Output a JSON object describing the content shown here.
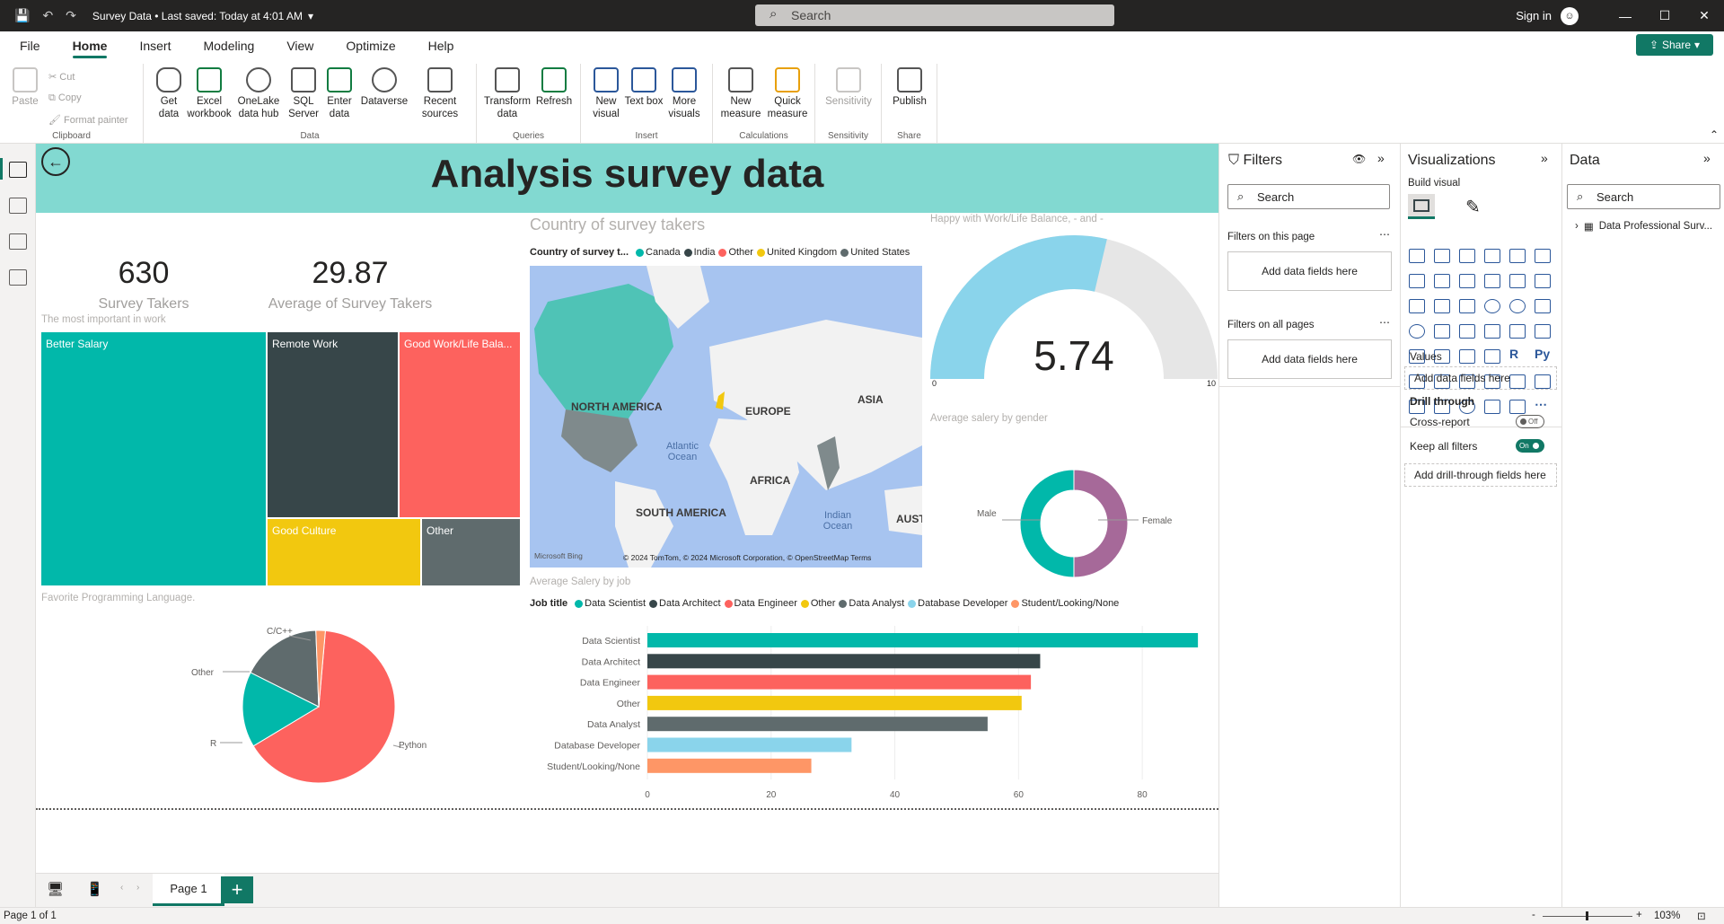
{
  "titlebar": {
    "doc_title": "Survey Data • Last saved: Today at 4:01 AM",
    "search_placeholder": "Search",
    "signin": "Sign in",
    "share": "Share"
  },
  "menu": [
    "File",
    "Home",
    "Insert",
    "Modeling",
    "View",
    "Optimize",
    "Help"
  ],
  "ribbon": {
    "clipboard": {
      "paste": "Paste",
      "cut": "Cut",
      "copy": "Copy",
      "format_painter": "Format painter",
      "label": "Clipboard"
    },
    "data": {
      "get_data": "Get data",
      "excel": "Excel workbook",
      "onelake": "OneLake data hub",
      "sql": "SQL Server",
      "enter": "Enter data",
      "dataverse": "Dataverse",
      "recent": "Recent sources",
      "label": "Data"
    },
    "queries": {
      "transform": "Transform data",
      "refresh": "Refresh",
      "label": "Queries"
    },
    "insert": {
      "new_visual": "New visual",
      "text_box": "Text box",
      "more_visuals": "More visuals",
      "label": "Insert"
    },
    "calculations": {
      "new_measure": "New measure",
      "quick_measure": "Quick measure",
      "label": "Calculations"
    },
    "sensitivity": {
      "sensitivity": "Sensitivity",
      "label": "Sensitivity"
    },
    "share": {
      "publish": "Publish",
      "label": "Share"
    }
  },
  "report": {
    "title": "Analysis survey data",
    "kpi1": {
      "value": "630",
      "label": "Survey Takers"
    },
    "kpi2": {
      "value": "29.87",
      "label": "Average of Survey Takers"
    },
    "treemap": {
      "title": "The most important in work",
      "tiles": [
        {
          "label": "Better Salary",
          "color": "#01b8aa"
        },
        {
          "label": "Remote Work",
          "color": "#374649"
        },
        {
          "label": "Good Work/Life Bala...",
          "color": "#fd625e"
        },
        {
          "label": "Good Culture",
          "color": "#f2c80f"
        },
        {
          "label": "Other",
          "color": "#5f6b6d"
        }
      ]
    },
    "map": {
      "title": "Country of survey takers",
      "legend_title": "Country of survey t...",
      "legend": [
        {
          "name": "Canada",
          "color": "#01b8aa"
        },
        {
          "name": "India",
          "color": "#374649"
        },
        {
          "name": "Other",
          "color": "#fd625e"
        },
        {
          "name": "United Kingdom",
          "color": "#f2c80f"
        },
        {
          "name": "United States",
          "color": "#5f6b6d"
        }
      ],
      "labels": {
        "na": "NORTH AMERICA",
        "eu": "EUROPE",
        "asia": "ASIA",
        "africa": "AFRICA",
        "sa": "SOUTH AMERICA",
        "aus": "AUST",
        "atlantic": "Atlantic Ocean",
        "indian": "Indian Ocean"
      },
      "footer": "© 2024 TomTom, © 2024 Microsoft Corporation, © OpenStreetMap  Terms",
      "bing": "Microsoft Bing"
    },
    "gauge": {
      "title": "Happy with Work/Life Balance, - and -",
      "value": 5.74,
      "value_text": "5.74",
      "min": 0,
      "max": 10,
      "min_text": "0",
      "max_text": "10"
    },
    "donut": {
      "title": "Average salery by gender",
      "male": "Male",
      "female": "Female"
    },
    "pie": {
      "title": "Favorite Programming Language.",
      "labels": {
        "cpp": "C/C++",
        "other": "Other",
        "r": "R",
        "python": "Python"
      }
    },
    "bar": {
      "title": "Average Salery by job",
      "legend_title": "Job title"
    }
  },
  "chart_data": [
    {
      "type": "bar",
      "orientation": "horizontal",
      "title": "Average Salery by job",
      "legend_title": "Job title",
      "categories": [
        "Data Scientist",
        "Data Architect",
        "Data Engineer",
        "Other",
        "Data Analyst",
        "Database Developer",
        "Student/Looking/None"
      ],
      "values": [
        89,
        63.5,
        62,
        60.5,
        55,
        33,
        26.5
      ],
      "colors": [
        "#01b8aa",
        "#374649",
        "#fd625e",
        "#f2c80f",
        "#5f6b6d",
        "#8ad4eb",
        "#fe9666"
      ],
      "xlim": [
        0,
        90
      ],
      "xticks": [
        0,
        20,
        40,
        60,
        80
      ]
    },
    {
      "type": "pie",
      "title": "Favorite Programming Language.",
      "categories": [
        "Python",
        "R",
        "Other",
        "C/C++"
      ],
      "values": [
        65,
        16,
        17,
        2
      ],
      "colors": [
        "#fd625e",
        "#01b8aa",
        "#5f6b6d",
        "#fe9666"
      ]
    },
    {
      "type": "pie",
      "subtype": "donut",
      "title": "Average salery by gender",
      "categories": [
        "Male",
        "Female"
      ],
      "values": [
        50,
        50
      ],
      "colors": [
        "#01b8aa",
        "#a66999"
      ]
    }
  ],
  "filters": {
    "title": "Filters",
    "search": "Search",
    "on_page": "Filters on this page",
    "on_all": "Filters on all pages",
    "add": "Add data fields here"
  },
  "viz": {
    "title": "Visualizations",
    "build": "Build visual",
    "values": "Values",
    "add_values": "Add data fields here",
    "drill": "Drill through",
    "cross": "Cross-report",
    "cross_state": "Off",
    "keep": "Keep all filters",
    "keep_state": "On",
    "add_drill": "Add drill-through fields here"
  },
  "data_pane": {
    "title": "Data",
    "search": "Search",
    "table": "Data Professional Surv..."
  },
  "pages": {
    "tab": "Page 1"
  },
  "status": {
    "page": "Page 1 of 1",
    "zoom": "103%"
  }
}
